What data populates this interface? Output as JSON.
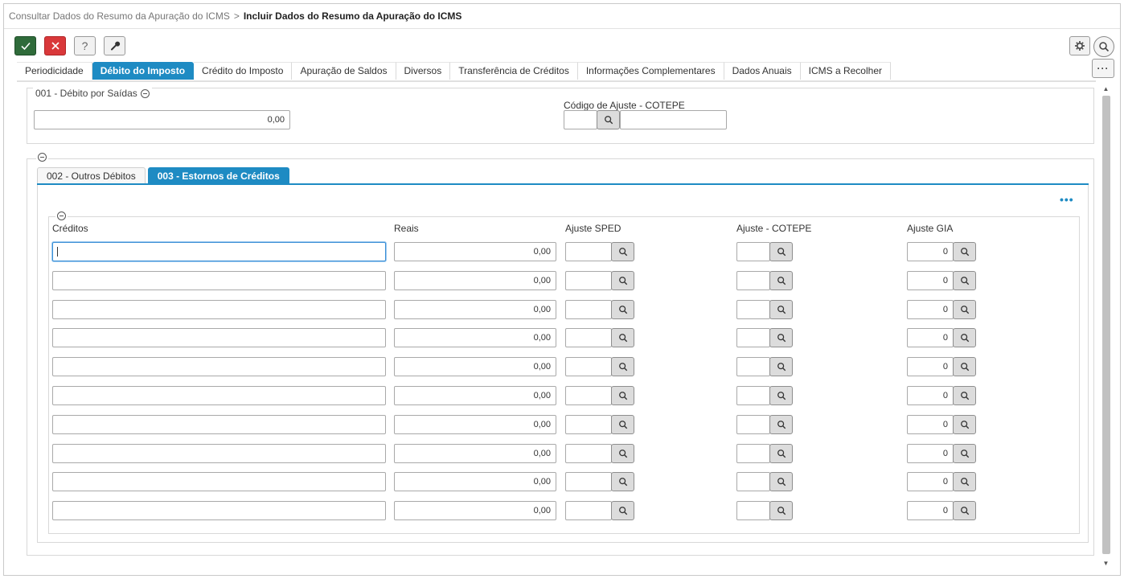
{
  "breadcrumb": {
    "parent": "Consultar Dados do Resumo da Apuração do ICMS",
    "separator": ">",
    "current": "Incluir Dados do Resumo da Apuração do ICMS"
  },
  "toolbar": {
    "help_label": "?",
    "more_label": "···"
  },
  "tabs": [
    {
      "label": "Periodicidade",
      "active": false
    },
    {
      "label": "Débito do Imposto",
      "active": true
    },
    {
      "label": "Crédito do Imposto",
      "active": false
    },
    {
      "label": "Apuração de Saldos",
      "active": false
    },
    {
      "label": "Diversos",
      "active": false
    },
    {
      "label": "Transferência de Créditos",
      "active": false
    },
    {
      "label": "Informações Complementares",
      "active": false
    },
    {
      "label": "Dados Anuais",
      "active": false
    },
    {
      "label": "ICMS a Recolher",
      "active": false
    }
  ],
  "debito_saidas": {
    "legend": "001 - Débito por Saídas",
    "value": "0,00",
    "ajuste_label": "Código de Ajuste - COTEPE",
    "ajuste_code": "",
    "ajuste_desc": ""
  },
  "subtabs": [
    {
      "label": "002 - Outros Débitos",
      "active": false
    },
    {
      "label": "003 - Estornos de Créditos",
      "active": true
    }
  ],
  "more_dots": "•••",
  "grid": {
    "headers": {
      "creditos": "Créditos",
      "reais": "Reais",
      "ajuste_sped": "Ajuste SPED",
      "ajuste_cotepe": "Ajuste - COTEPE",
      "ajuste_gia": "Ajuste GIA"
    },
    "rows": [
      {
        "creditos": "",
        "reais": "0,00",
        "sped": "",
        "cotepe": "",
        "gia": "0"
      },
      {
        "creditos": "",
        "reais": "0,00",
        "sped": "",
        "cotepe": "",
        "gia": "0"
      },
      {
        "creditos": "",
        "reais": "0,00",
        "sped": "",
        "cotepe": "",
        "gia": "0"
      },
      {
        "creditos": "",
        "reais": "0,00",
        "sped": "",
        "cotepe": "",
        "gia": "0"
      },
      {
        "creditos": "",
        "reais": "0,00",
        "sped": "",
        "cotepe": "",
        "gia": "0"
      },
      {
        "creditos": "",
        "reais": "0,00",
        "sped": "",
        "cotepe": "",
        "gia": "0"
      },
      {
        "creditos": "",
        "reais": "0,00",
        "sped": "",
        "cotepe": "",
        "gia": "0"
      },
      {
        "creditos": "",
        "reais": "0,00",
        "sped": "",
        "cotepe": "",
        "gia": "0"
      },
      {
        "creditos": "",
        "reais": "0,00",
        "sped": "",
        "cotepe": "",
        "gia": "0"
      },
      {
        "creditos": "",
        "reais": "0,00",
        "sped": "",
        "cotepe": "",
        "gia": "0"
      }
    ]
  },
  "colors": {
    "accent": "#1e8bc3",
    "confirm": "#2f6b3a",
    "cancel": "#d9383a"
  }
}
